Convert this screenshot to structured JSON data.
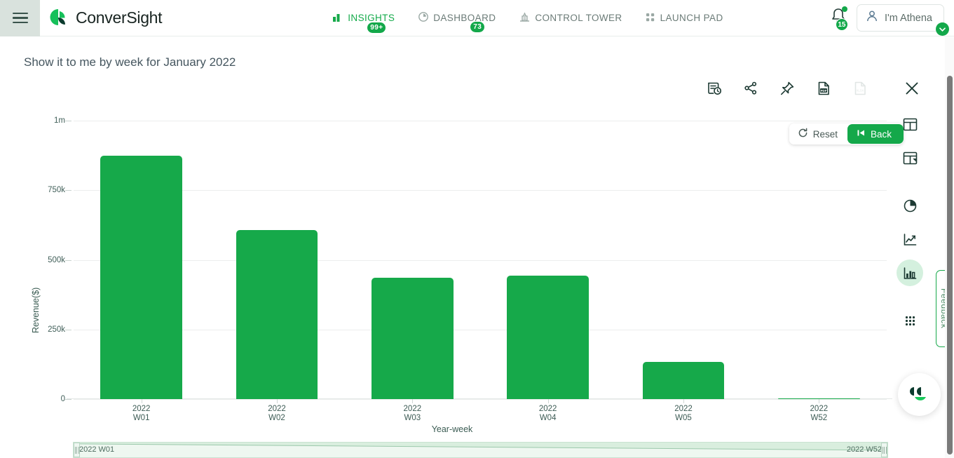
{
  "header": {
    "menu_icon": "hamburger-icon",
    "brand": "ConverSight",
    "nav": [
      {
        "label": "INSIGHTS",
        "icon": "bar-chart-icon",
        "badge": "99+",
        "active": true
      },
      {
        "label": "DASHBOARD",
        "icon": "gauge-icon",
        "badge": "73",
        "active": false
      },
      {
        "label": "CONTROL TOWER",
        "icon": "control-tower-icon",
        "badge": "",
        "active": false
      },
      {
        "label": "LAUNCH PAD",
        "icon": "grid-dots-icon",
        "badge": "",
        "active": false
      }
    ],
    "notifications": {
      "icon": "bell-icon",
      "badge": "15"
    },
    "user": {
      "label": "I'm Athena",
      "icon": "user-icon",
      "caret": "chevron-down-icon"
    }
  },
  "query": {
    "title": "Show it to me by week for January 2022"
  },
  "toolbar": [
    {
      "name": "history-icon",
      "label": "History",
      "disabled": false
    },
    {
      "name": "share-icon",
      "label": "Share",
      "disabled": false
    },
    {
      "name": "pin-icon",
      "label": "Pin",
      "disabled": false
    },
    {
      "name": "export-pdf-icon",
      "label": "Export PDF",
      "disabled": false
    },
    {
      "name": "export-xlsx-icon",
      "label": "Export XLSX",
      "disabled": true
    },
    {
      "name": "close-icon",
      "label": "Close",
      "disabled": false
    }
  ],
  "right_rail": [
    {
      "name": "table-view-icon",
      "label": "Table",
      "active": false
    },
    {
      "name": "pivot-table-icon",
      "label": "Pivot Table",
      "active": false
    },
    {
      "name": "pie-chart-icon",
      "label": "Pie Chart",
      "active": false
    },
    {
      "name": "line-chart-icon",
      "label": "Line Chart",
      "active": false
    },
    {
      "name": "bar-chart-icon",
      "label": "Bar Chart",
      "active": true
    },
    {
      "name": "more-options-icon",
      "label": "More",
      "active": false
    }
  ],
  "chart_controls": {
    "reset_label": "Reset",
    "reset_icon": "refresh-icon",
    "back_label": "Back",
    "back_icon": "skip-back-icon"
  },
  "range_slider": {
    "start_label": "2022 W01",
    "end_label": "2022 W52"
  },
  "feedback": {
    "label": "Feedback"
  },
  "chat": {
    "icon": "athena-assistant-icon"
  },
  "colors": {
    "brand_green": "#16a94a",
    "dark_green": "#0b3b2e",
    "bar": "#16a94a",
    "text_muted": "#6b7b77",
    "axis_text": "#3c5b54"
  },
  "chart_data": {
    "type": "bar",
    "title": "",
    "xlabel": "Year-week",
    "ylabel": "Revenue($)",
    "categories": [
      "2022\nW01",
      "2022\nW02",
      "2022\nW03",
      "2022\nW04",
      "2022\nW05",
      "2022\nW52"
    ],
    "category_lines": [
      [
        "2022",
        "W01"
      ],
      [
        "2022",
        "W02"
      ],
      [
        "2022",
        "W03"
      ],
      [
        "2022",
        "W04"
      ],
      [
        "2022",
        "W05"
      ],
      [
        "2022",
        "W52"
      ]
    ],
    "values": [
      874000,
      607000,
      436000,
      443000,
      133000,
      2000
    ],
    "ylim": [
      0,
      1000000
    ],
    "ytick_values": [
      0,
      250000,
      500000,
      750000,
      1000000
    ],
    "ytick_labels": [
      "0",
      "250k",
      "500k",
      "750k",
      "1m"
    ],
    "grid": true,
    "legend": "none",
    "series_color": "#16a94a"
  }
}
